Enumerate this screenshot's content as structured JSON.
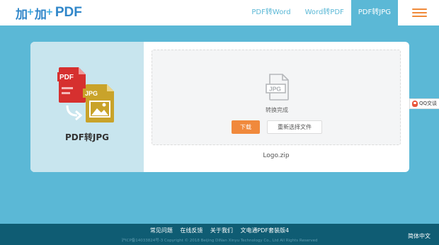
{
  "header": {
    "logo_mark": "加加",
    "logo_text": "PDF",
    "nav": [
      {
        "label": "PDF转Word",
        "active": false
      },
      {
        "label": "Word转PDF",
        "active": false
      },
      {
        "label": "PDF转JPG",
        "active": true
      }
    ],
    "menu_icon": "hamburger-menu-icon"
  },
  "converter": {
    "title": "PDF转JPG",
    "icon_labels": {
      "source": "PDF",
      "target": "JPG"
    },
    "file_icon_label": "JPG",
    "status": "转换完成",
    "download_label": "下载",
    "reselect_label": "重新选择文件",
    "file_name": "Logo.zip"
  },
  "qq": {
    "label": "QQ交谈"
  },
  "footer": {
    "links": [
      "常见问题",
      "在线反馈",
      "关于我们",
      "文电通PDF套装版4"
    ],
    "copyright": "沪ICP备14033824号-3 Copyright © 2018 Beijing DiNan Xinyu Technology Co., Ltd All Rights Reserved",
    "language": "简体中文"
  },
  "colors": {
    "background": "#5bb8d6",
    "accent_orange": "#f0893c",
    "brand_blue": "#2f86c9",
    "footer_bg": "#0f5c73",
    "left_panel": "#c8e5ee"
  }
}
